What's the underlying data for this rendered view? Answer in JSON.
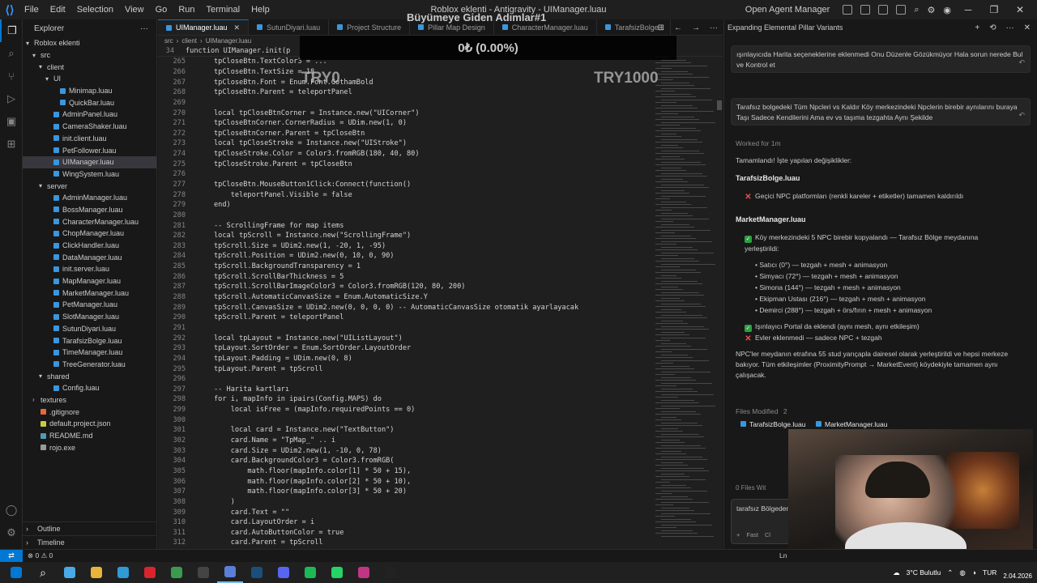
{
  "titlebar": {
    "logo": "vscode-logo-icon",
    "menu": [
      "File",
      "Edit",
      "Selection",
      "View",
      "Go",
      "Run",
      "Terminal",
      "Help"
    ],
    "title": "Roblox eklenti - Antigravity - UIManager.luau",
    "agent_label": "Open Agent Manager"
  },
  "activity": [
    "files-icon",
    "search-icon",
    "source-control-icon",
    "run-debug-icon",
    "remote-icon",
    "extensions-icon"
  ],
  "explorer": {
    "header": "Explorer",
    "tree": [
      {
        "label": "Roblox eklenti",
        "depth": 0,
        "chev": "▾",
        "type": "folder"
      },
      {
        "label": "src",
        "depth": 1,
        "chev": "▾",
        "type": "folder"
      },
      {
        "label": "client",
        "depth": 2,
        "chev": "▾",
        "type": "folder"
      },
      {
        "label": "UI",
        "depth": 3,
        "chev": "▾",
        "type": "folder"
      },
      {
        "label": "Minimap.luau",
        "depth": 4,
        "type": "file"
      },
      {
        "label": "QuickBar.luau",
        "depth": 4,
        "type": "file"
      },
      {
        "label": "AdminPanel.luau",
        "depth": 3,
        "type": "file"
      },
      {
        "label": "CameraShaker.luau",
        "depth": 3,
        "type": "file"
      },
      {
        "label": "init.client.luau",
        "depth": 3,
        "type": "file"
      },
      {
        "label": "PetFollower.luau",
        "depth": 3,
        "type": "file"
      },
      {
        "label": "UIManager.luau",
        "depth": 3,
        "type": "file",
        "selected": true
      },
      {
        "label": "WingSystem.luau",
        "depth": 3,
        "type": "file"
      },
      {
        "label": "server",
        "depth": 2,
        "chev": "▾",
        "type": "folder"
      },
      {
        "label": "AdminManager.luau",
        "depth": 3,
        "type": "file"
      },
      {
        "label": "BossManager.luau",
        "depth": 3,
        "type": "file"
      },
      {
        "label": "CharacterManager.luau",
        "depth": 3,
        "type": "file"
      },
      {
        "label": "ChopManager.luau",
        "depth": 3,
        "type": "file"
      },
      {
        "label": "ClickHandler.luau",
        "depth": 3,
        "type": "file"
      },
      {
        "label": "DataManager.luau",
        "depth": 3,
        "type": "file"
      },
      {
        "label": "init.server.luau",
        "depth": 3,
        "type": "file"
      },
      {
        "label": "MapManager.luau",
        "depth": 3,
        "type": "file"
      },
      {
        "label": "MarketManager.luau",
        "depth": 3,
        "type": "file"
      },
      {
        "label": "PetManager.luau",
        "depth": 3,
        "type": "file"
      },
      {
        "label": "SlotManager.luau",
        "depth": 3,
        "type": "file"
      },
      {
        "label": "SutunDiyari.luau",
        "depth": 3,
        "type": "file"
      },
      {
        "label": "TarafsizBolge.luau",
        "depth": 3,
        "type": "file"
      },
      {
        "label": "TimeManager.luau",
        "depth": 3,
        "type": "file"
      },
      {
        "label": "TreeGenerator.luau",
        "depth": 3,
        "type": "file"
      },
      {
        "label": "shared",
        "depth": 2,
        "chev": "▾",
        "type": "folder"
      },
      {
        "label": "Config.luau",
        "depth": 3,
        "type": "file"
      },
      {
        "label": "textures",
        "depth": 1,
        "chev": "›",
        "type": "folder"
      },
      {
        "label": ".gitignore",
        "depth": 1,
        "type": "git"
      },
      {
        "label": "default.project.json",
        "depth": 1,
        "type": "json"
      },
      {
        "label": "README.md",
        "depth": 1,
        "type": "md"
      },
      {
        "label": "rojo.exe",
        "depth": 1,
        "type": "exe"
      }
    ],
    "outline": "Outline",
    "timeline": "Timeline"
  },
  "editor": {
    "tabs": [
      {
        "label": "UIManager.luau",
        "active": true
      },
      {
        "label": "SutunDiyari.luau",
        "active": false
      },
      {
        "label": "Project Structure",
        "active": false
      },
      {
        "label": "Pillar Map Design",
        "active": false
      },
      {
        "label": "CharacterManager.luau",
        "active": false
      },
      {
        "label": "TarafsizBolge.l",
        "active": false
      }
    ],
    "breadcrumb": [
      "src",
      "client",
      "UIManager.luau"
    ],
    "sticky": {
      "num": "34",
      "text": "function UIManager.init(p"
    },
    "lines": [
      {
        "n": "265",
        "t": "tpCloseBtn.TextColor3 = ..."
      },
      {
        "n": "266",
        "t": "tpCloseBtn.TextSize = 18"
      },
      {
        "n": "267",
        "t": "tpCloseBtn.Font = Enum.Font.GothamBold"
      },
      {
        "n": "268",
        "t": "tpCloseBtn.Parent = teleportPanel"
      },
      {
        "n": "269",
        "t": ""
      },
      {
        "n": "270",
        "t": "local tpCloseBtnCorner = Instance.new(\"UICorner\")"
      },
      {
        "n": "271",
        "t": "tpCloseBtnCorner.CornerRadius = UDim.new(1, 0)"
      },
      {
        "n": "272",
        "t": "tpCloseBtnCorner.Parent = tpCloseBtn"
      },
      {
        "n": "273",
        "t": "local tpCloseStroke = Instance.new(\"UIStroke\")"
      },
      {
        "n": "274",
        "t": "tpCloseStroke.Color = Color3.fromRGB(180, 40, 80)"
      },
      {
        "n": "275",
        "t": "tpCloseStroke.Parent = tpCloseBtn"
      },
      {
        "n": "276",
        "t": ""
      },
      {
        "n": "277",
        "t": "tpCloseBtn.MouseButton1Click:Connect(function()"
      },
      {
        "n": "278",
        "t": "    teleportPanel.Visible = false"
      },
      {
        "n": "279",
        "t": "end)"
      },
      {
        "n": "280",
        "t": ""
      },
      {
        "n": "281",
        "t": "-- ScrollingFrame for map items"
      },
      {
        "n": "282",
        "t": "local tpScroll = Instance.new(\"ScrollingFrame\")"
      },
      {
        "n": "283",
        "t": "tpScroll.Size = UDim2.new(1, -20, 1, -95)"
      },
      {
        "n": "284",
        "t": "tpScroll.Position = UDim2.new(0, 10, 0, 90)"
      },
      {
        "n": "285",
        "t": "tpScroll.BackgroundTransparency = 1"
      },
      {
        "n": "286",
        "t": "tpScroll.ScrollBarThickness = 5"
      },
      {
        "n": "287",
        "t": "tpScroll.ScrollBarImageColor3 = Color3.fromRGB(120, 80, 200)"
      },
      {
        "n": "288",
        "t": "tpScroll.AutomaticCanvasSize = Enum.AutomaticSize.Y"
      },
      {
        "n": "289",
        "t": "tpScroll.CanvasSize = UDim2.new(0, 0, 0, 0) -- AutomaticCanvasSize otomatik ayarlayacak"
      },
      {
        "n": "290",
        "t": "tpScroll.Parent = teleportPanel"
      },
      {
        "n": "291",
        "t": ""
      },
      {
        "n": "292",
        "t": "local tpLayout = Instance.new(\"UIListLayout\")"
      },
      {
        "n": "293",
        "t": "tpLayout.SortOrder = Enum.SortOrder.LayoutOrder"
      },
      {
        "n": "294",
        "t": "tpLayout.Padding = UDim.new(0, 8)"
      },
      {
        "n": "295",
        "t": "tpLayout.Parent = tpScroll"
      },
      {
        "n": "296",
        "t": ""
      },
      {
        "n": "297",
        "t": "-- Harita kartları"
      },
      {
        "n": "298",
        "t": "for i, mapInfo in ipairs(Config.MAPS) do"
      },
      {
        "n": "299",
        "t": "    local isFree = (mapInfo.requiredPoints == 0)"
      },
      {
        "n": "300",
        "t": ""
      },
      {
        "n": "301",
        "t": "    local card = Instance.new(\"TextButton\")"
      },
      {
        "n": "302",
        "t": "    card.Name = \"TpMap_\" .. i"
      },
      {
        "n": "303",
        "t": "    card.Size = UDim2.new(1, -10, 0, 78)"
      },
      {
        "n": "304",
        "t": "    card.BackgroundColor3 = Color3.fromRGB("
      },
      {
        "n": "305",
        "t": "        math.floor(mapInfo.color[1] * 50 + 15),"
      },
      {
        "n": "306",
        "t": "        math.floor(mapInfo.color[2] * 50 + 10),"
      },
      {
        "n": "307",
        "t": "        math.floor(mapInfo.color[3] * 50 + 20)"
      },
      {
        "n": "308",
        "t": "    )"
      },
      {
        "n": "309",
        "t": "    card.Text = \"\""
      },
      {
        "n": "310",
        "t": "    card.LayoutOrder = i"
      },
      {
        "n": "311",
        "t": "    card.AutoButtonColor = true"
      },
      {
        "n": "312",
        "t": "    card.Parent = tpScroll"
      }
    ]
  },
  "overlay": {
    "title": "Büyümeye Giden Adımlar#1",
    "amount": "0₺ (0.00%)",
    "try_left": "TRY0",
    "try_right": "TRY1000"
  },
  "panel": {
    "title": "Expanding Elemental Pillar Variants",
    "msg1": "ışınlayıcıda Harita seçeneklerine eklenmedi Onu Düzenle Gözükmüyor Hala sorun nerede Bul ve Kontrol et",
    "msg2": "Tarafsız bolgedeki Tüm Npcleri vs Kaldır Köy merkezindeki Npclerin birebir aynılarını buraya Taşı Sadece Kendilerini Ama ev vs taşıma tezgahta Aynı Şekilde",
    "worked": "Worked for 1m",
    "done": "Tamamlandı! İşte yapılan değişiklikler:",
    "h1": "TarafsizBolge.luau",
    "b1": "Geçici NPC platformları (renkli kareler + etiketler) tamamen kaldırıldı",
    "h2": "MarketManager.luau",
    "b2": "Köy merkezindeki 5 NPC birebir kopyalandı — Tarafsız Bölge meydanına yerleştirildi:",
    "subs": [
      "Satıcı (0°) — tezgah + mesh + animasyon",
      "Simyacı (72°) — tezgah + mesh + animasyon",
      "Simona (144°) — tezgah + mesh + animasyon",
      "Ekipman Ustası (216°) — tezgah + mesh + animasyon",
      "Demirci (288°) — tezgah + örs/fırın + mesh + animasyon"
    ],
    "b3": "Işınlayıcı Portal da eklendi (aynı mesh, aynı etkileşim)",
    "b4": "Evler eklenmedi — sadece NPC + tezgah",
    "summary": "NPC'ler meydanın etrafına 55 stud yarıçapla dairesel olarak yerleştirildi ve hepsi merkeze bakıyor. Tüm etkileşimler (ProximityPrompt → MarketEvent) köydekiyle tamamen aynı çalışacak.",
    "files_label": "Files Modified",
    "files_count": "2",
    "file1": "TarafsizBolge.luau",
    "file2": "MarketManager.luau",
    "no_files": "0 Files Wit",
    "input_text": "tarafsız Bölgeden Bana",
    "input_ctrl": [
      "+",
      "Fast",
      "Cl"
    ]
  },
  "statusbar": {
    "problems": "⊗ 0 ⚠ 0",
    "ln": "Ln"
  },
  "taskbar": {
    "apps": [
      {
        "name": "windows-start-icon",
        "color": "#0078d4"
      },
      {
        "name": "search-icon",
        "color": "#ffffff"
      },
      {
        "name": "copilot-icon",
        "color": "#4aa8e8"
      },
      {
        "name": "file-explorer-icon",
        "color": "#e8b43a"
      },
      {
        "name": "edge-icon",
        "color": "#2f9ad6"
      },
      {
        "name": "acrobat-icon",
        "color": "#d9232d"
      },
      {
        "name": "chrome-icon",
        "color": "#3a9b4c"
      },
      {
        "name": "terminal-icon",
        "color": "#444444"
      },
      {
        "name": "antigravity-icon",
        "color": "#5b7fd6"
      },
      {
        "name": "steam-icon",
        "color": "#1b4f7a"
      },
      {
        "name": "discord-icon",
        "color": "#5865f2"
      },
      {
        "name": "spotify-icon",
        "color": "#1db954"
      },
      {
        "name": "whatsapp-icon",
        "color": "#25d366"
      },
      {
        "name": "instagram-icon",
        "color": "#c13584"
      },
      {
        "name": "capcut-icon",
        "color": "#222222"
      }
    ],
    "weather": "3°C Bulutlu",
    "lang": "TUR",
    "date": "2.04.2026"
  }
}
